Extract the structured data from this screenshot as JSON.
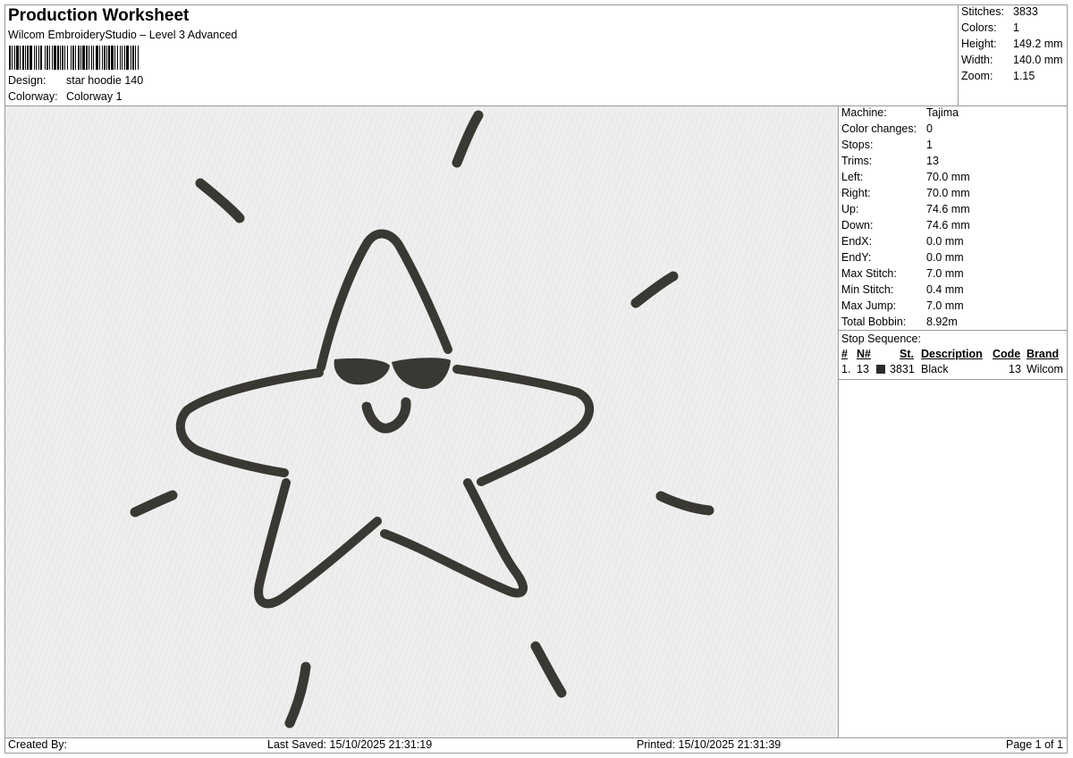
{
  "header": {
    "title": "Production Worksheet",
    "subtitle": "Wilcom EmbroideryStudio – Level 3 Advanced",
    "design_label": "Design:",
    "design_value": "star hoodie 140",
    "colorway_label": "Colorway:",
    "colorway_value": "Colorway 1"
  },
  "summary": {
    "stitches_label": "Stitches:",
    "stitches": "3833",
    "colors_label": "Colors:",
    "colors": "1",
    "height_label": "Height:",
    "height": "149.2 mm",
    "width_label": "Width:",
    "width": "140.0 mm",
    "zoom_label": "Zoom:",
    "zoom": "1.15"
  },
  "machine_info": [
    {
      "label": "Machine:",
      "value": "Tajima"
    },
    {
      "label": "Color changes:",
      "value": "0"
    },
    {
      "label": "Stops:",
      "value": "1"
    },
    {
      "label": "Trims:",
      "value": "13"
    },
    {
      "label": "Left:",
      "value": "70.0 mm"
    },
    {
      "label": "Right:",
      "value": "70.0 mm"
    },
    {
      "label": "Up:",
      "value": "74.6 mm"
    },
    {
      "label": "Down:",
      "value": "74.6 mm"
    },
    {
      "label": "EndX:",
      "value": "0.0 mm"
    },
    {
      "label": "EndY:",
      "value": "0.0 mm"
    },
    {
      "label": "Max Stitch:",
      "value": "7.0 mm"
    },
    {
      "label": "Min Stitch:",
      "value": "0.4 mm"
    },
    {
      "label": "Max Jump:",
      "value": "7.0 mm"
    },
    {
      "label": "Total Bobbin:",
      "value": "8.92m"
    }
  ],
  "stop_sequence": {
    "title": "Stop Sequence:",
    "headers": {
      "index": "#",
      "needle": "N#",
      "stitches": "St.",
      "description": "Description",
      "code": "Code",
      "brand": "Brand"
    },
    "rows": [
      {
        "index": "1.",
        "needle": "13",
        "color": "#2a2a2a",
        "stitches": "3831",
        "description": "Black",
        "code": "13",
        "brand": "Wilcom"
      }
    ]
  },
  "footer": {
    "created_by": "Created By:",
    "last_saved": "Last Saved: 15/10/2025 21:31:19",
    "printed": "Printed: 15/10/2025 21:31:39",
    "page": "Page 1 of 1"
  },
  "design_colors": {
    "thread": "#3a3832",
    "background": "#eeeeee"
  }
}
